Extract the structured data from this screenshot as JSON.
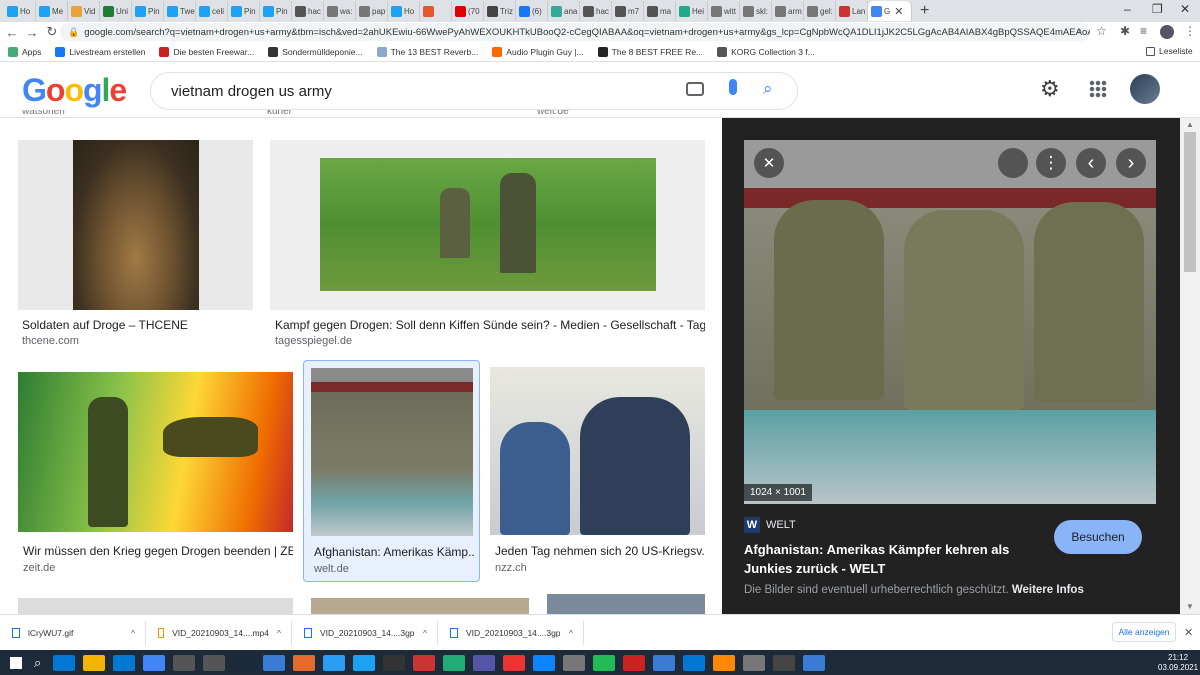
{
  "tabs": [
    {
      "label": "Ho",
      "color": "#1da1f2"
    },
    {
      "label": "Me",
      "color": "#1da1f2"
    },
    {
      "label": "Vid",
      "color": "#e8a33c"
    },
    {
      "label": "Uni",
      "color": "#1e7d33"
    },
    {
      "label": "Pin",
      "color": "#1da1f2"
    },
    {
      "label": "Twe",
      "color": "#1da1f2"
    },
    {
      "label": "celi",
      "color": "#1da1f2"
    },
    {
      "label": "Pin",
      "color": "#1da1f2"
    },
    {
      "label": "Pin",
      "color": "#1da1f2"
    },
    {
      "label": "hac",
      "color": "#555"
    },
    {
      "label": "wa:",
      "color": "#777"
    },
    {
      "label": "pap",
      "color": "#777"
    },
    {
      "label": "Ho",
      "color": "#1da1f2"
    },
    {
      "label": "",
      "color": "#e4572e"
    },
    {
      "label": "(70",
      "color": "#d00"
    },
    {
      "label": "Triz",
      "color": "#444"
    },
    {
      "label": "(6)",
      "color": "#1877f2"
    },
    {
      "label": "ana",
      "color": "#3a9"
    },
    {
      "label": "hac",
      "color": "#555"
    },
    {
      "label": "m7",
      "color": "#555"
    },
    {
      "label": "ma",
      "color": "#555"
    },
    {
      "label": "Hei",
      "color": "#2a8"
    },
    {
      "label": "witt",
      "color": "#777"
    },
    {
      "label": "skl:",
      "color": "#777"
    },
    {
      "label": "arm",
      "color": "#777"
    },
    {
      "label": "gel:",
      "color": "#777"
    },
    {
      "label": "Lan",
      "color": "#c33"
    }
  ],
  "active_tab": {
    "label": "G"
  },
  "window": {
    "new_tab": "+",
    "min": "–",
    "max": "❐",
    "close": "✕",
    "tab_close": "✕"
  },
  "url": "google.com/search?q=vietnam+drogen+us+army&tbm=isch&ved=2ahUKEwiu-66WwePyAhWEXOUKHTkUBooQ2-cCegQIABAA&oq=vietnam+drogen+us+army&gs_lcp=CgNpbWcQA1DLI1jJK2C5LGgAcAB4AIABX4gBpQSSAQE4mAEAoAEBqgELZ3dzLX",
  "nav": {
    "back": "←",
    "forward": "→",
    "reload": "↻"
  },
  "bookmarks": [
    {
      "label": "Apps"
    },
    {
      "label": "Livestream erstellen"
    },
    {
      "label": "Die besten Freewar..."
    },
    {
      "label": "Sondermülldeponie..."
    },
    {
      "label": "The 13 BEST Reverb..."
    },
    {
      "label": "Audio Plugin Guy |..."
    },
    {
      "label": "The 8 BEST FREE Re..."
    },
    {
      "label": "KORG Collection 3 f..."
    }
  ],
  "reading_list": "Leseliste",
  "google": {
    "logo_letters": [
      "G",
      "o",
      "o",
      "g",
      "l",
      "e"
    ],
    "logo_colors": [
      "#4285f4",
      "#ea4335",
      "#fbbc05",
      "#4285f4",
      "#34a853",
      "#ea4335"
    ],
    "query": "vietnam drogen us army"
  },
  "cut_labels": [
    "watsonen",
    "kurier",
    "welt.de"
  ],
  "results": [
    {
      "caption": "Soldaten auf Droge – THCENE",
      "domain": "thcene.com"
    },
    {
      "caption": "Kampf gegen Drogen: Soll denn Kiffen Sünde sein? - Medien - Gesellschaft - Tage...",
      "domain": "tagesspiegel.de"
    },
    {
      "caption": "Wir müssen den Krieg gegen Drogen beenden | ZE...",
      "domain": "zeit.de"
    },
    {
      "caption": "Afghanistan: Amerikas Kämp...",
      "domain": "welt.de"
    },
    {
      "caption": "Jeden Tag nehmen sich 20 US-Kriegsv...",
      "domain": "nzz.ch"
    }
  ],
  "panel": {
    "dimensions": "1024 × 1001",
    "source_letter": "W",
    "source": "WELT",
    "title": "Afghanistan: Amerikas Kämpfer kehren als Junkies zurück - WELT",
    "visit": "Besuchen",
    "notice": "Die Bilder sind eventuell urheberrechtlich geschützt.",
    "more_info": "Weitere Infos",
    "close": "✕",
    "prev": "‹",
    "next": "›",
    "more": "⋮"
  },
  "downloads": [
    {
      "name": "lCryWU7.gif"
    },
    {
      "name": "VID_20210903_14....mp4"
    },
    {
      "name": "VID_20210903_14....3gp"
    },
    {
      "name": "VID_20210903_14....3gp"
    }
  ],
  "download_caret": "^",
  "show_all": "Alle anzeigen",
  "close_downloads": "✕",
  "clock": {
    "time": "21:12",
    "date": "03.09.2021"
  }
}
